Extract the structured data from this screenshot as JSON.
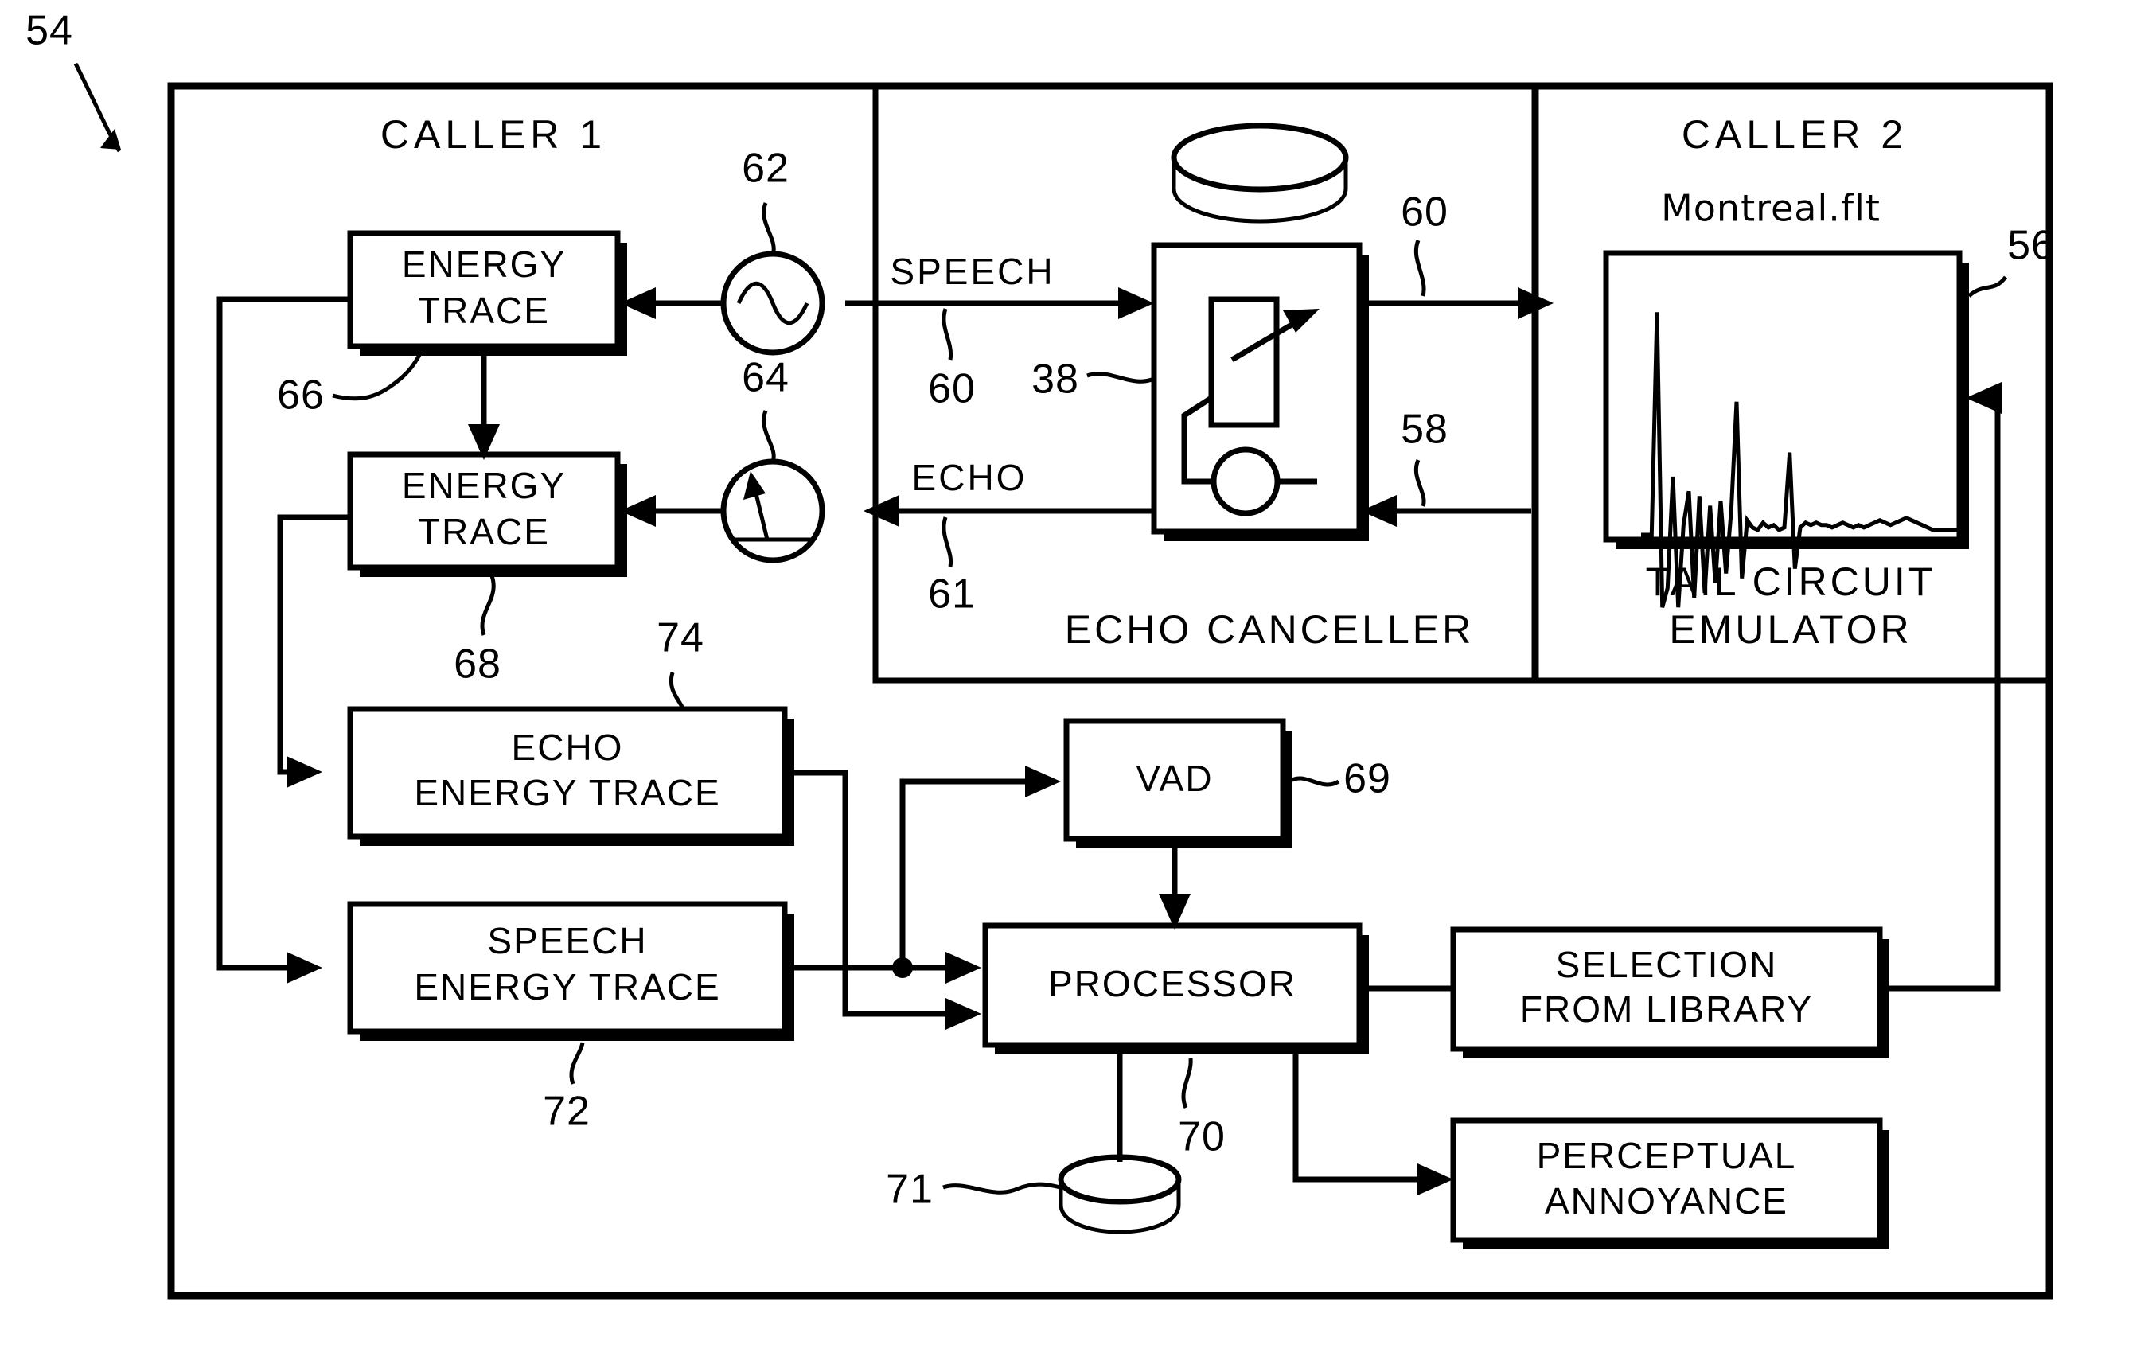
{
  "figure": {
    "figure_ref": "54",
    "panels": [
      {
        "id": "caller1",
        "title": "CALLER 1"
      },
      {
        "id": "caller2",
        "title": "CALLER 2"
      }
    ],
    "caller2_filename": "Montreal.flt",
    "caller2_caption_line1": "TAIL CIRCUIT",
    "caller2_caption_line2": "EMULATOR",
    "echo_canceller_caption": "ECHO CANCELLER"
  },
  "blocks": {
    "energy_trace_1": {
      "line1": "ENERGY",
      "line2": "TRACE",
      "ref": "66"
    },
    "energy_trace_2": {
      "line1": "ENERGY",
      "line2": "TRACE",
      "ref": "68"
    },
    "echo_energy_trace": {
      "line1": "ECHO",
      "line2": "ENERGY TRACE",
      "ref": "74"
    },
    "speech_energy_trace": {
      "line1": "SPEECH",
      "line2": "ENERGY TRACE",
      "ref": "72"
    },
    "vad": {
      "line1": "VAD",
      "ref": "69"
    },
    "processor": {
      "line1": "PROCESSOR",
      "ref": "70"
    },
    "selection_from_library": {
      "line1": "SELECTION",
      "line2": "FROM LIBRARY"
    },
    "perceptual_annoyance": {
      "line1": "PERCEPTUAL",
      "line2": "ANNOYANCE"
    },
    "echo_canceller": {
      "ref": "38"
    },
    "tail_circuit_emulator": {
      "ref": "56"
    }
  },
  "signals": {
    "speech_label": "SPEECH",
    "speech_ref": "60",
    "echo_label": "ECHO",
    "echo_ref": "61",
    "out_ref": "60",
    "return_ref": "58"
  },
  "symbols": {
    "signal_generator": {
      "ref": "62",
      "icon": "sine-wave-source-icon"
    },
    "level_meter": {
      "ref": "64",
      "icon": "meter-gauge-icon"
    },
    "database_top": {
      "icon": "cylinder-database-icon"
    },
    "database_processor": {
      "ref": "71",
      "icon": "cylinder-database-icon"
    }
  },
  "colors": {
    "ink": "#000000",
    "paper": "#ffffff"
  },
  "chart_data": {
    "type": "line",
    "title": "Montreal.flt",
    "xlabel": "",
    "ylabel": "",
    "description": "Tail circuit impulse response trace",
    "x": [
      0,
      1,
      2,
      3,
      4,
      5,
      6,
      7,
      8,
      9,
      10,
      11,
      12,
      13,
      14,
      15,
      16,
      17,
      18,
      19,
      20,
      21,
      22,
      23,
      24,
      25,
      26,
      27,
      28,
      29,
      30,
      31,
      32,
      33,
      34,
      35,
      36,
      37,
      38,
      39,
      40,
      41,
      42,
      43,
      44,
      45,
      46,
      47,
      48,
      49,
      50,
      51,
      52,
      53,
      54,
      55,
      56,
      57,
      58,
      59,
      60
    ],
    "values": [
      0,
      0,
      0,
      0.92,
      -0.3,
      -0.22,
      0.24,
      -0.3,
      0.04,
      0.18,
      -0.26,
      0.16,
      -0.24,
      0.12,
      -0.2,
      0.14,
      -0.16,
      0.1,
      0.55,
      -0.18,
      0.06,
      0.03,
      0.02,
      0.05,
      0.03,
      0.04,
      0.02,
      0.03,
      0.34,
      -0.14,
      0.03,
      0.05,
      0.04,
      0.05,
      0.04,
      0.04,
      0.03,
      0.04,
      0.05,
      0.04,
      0.03,
      0.04,
      0.03,
      0.04,
      0.05,
      0.06,
      0.05,
      0.04,
      0.05,
      0.06,
      0.07,
      0.06,
      0.05,
      0.04,
      0.03,
      0.02,
      0.02,
      0.02,
      0.02,
      0.02,
      0.02
    ],
    "ylim": [
      -0.45,
      1.0
    ],
    "grid": false,
    "legend": false
  }
}
